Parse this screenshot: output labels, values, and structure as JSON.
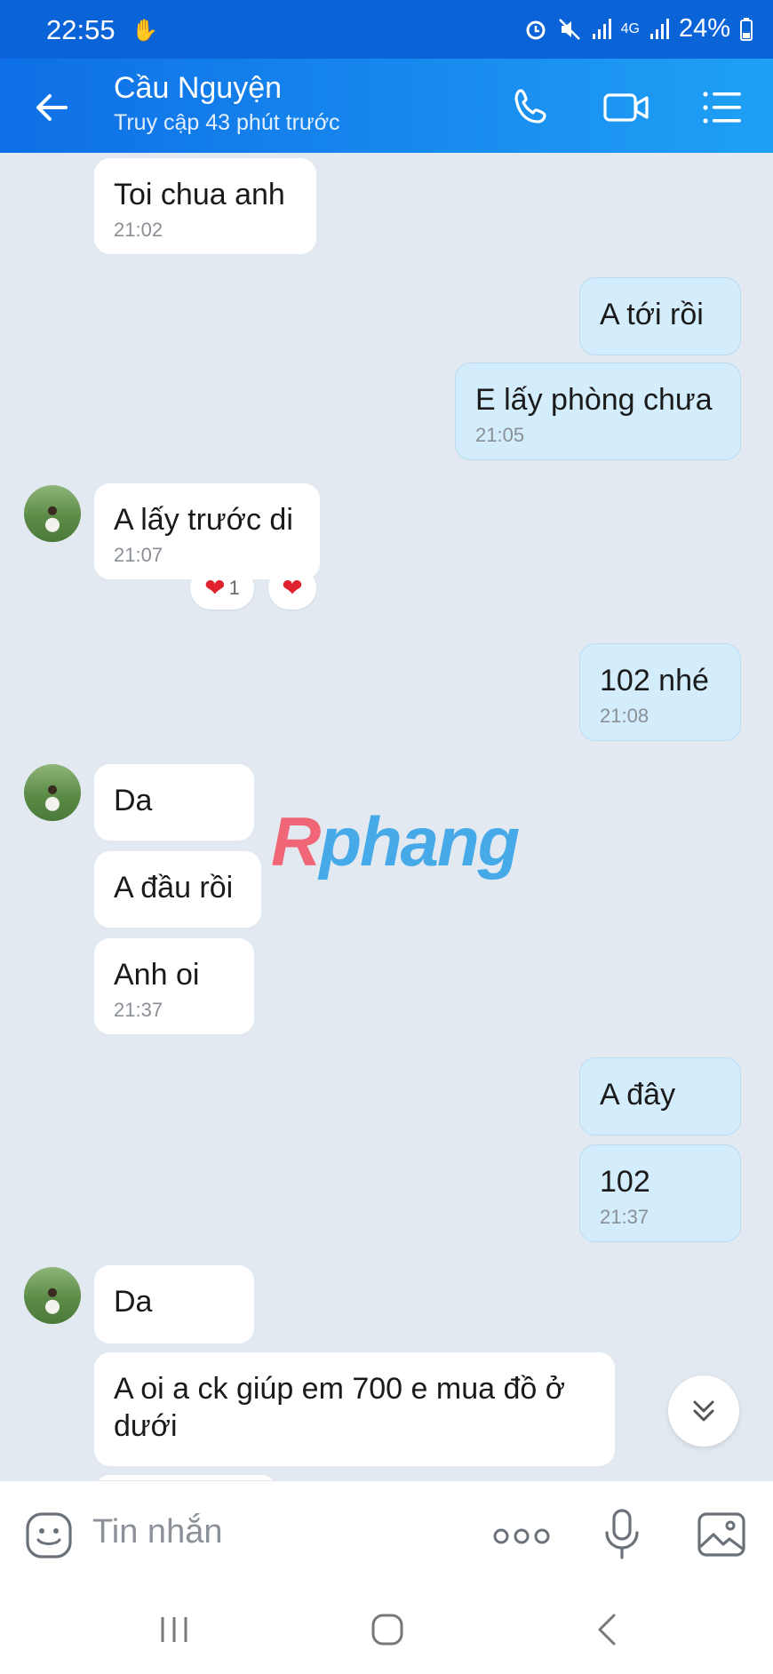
{
  "status_bar": {
    "time": "22:55",
    "battery": "24%",
    "network": "4G"
  },
  "header": {
    "contact_name": "Cầu Nguyện",
    "contact_status": "Truy cập 43 phút trước"
  },
  "messages": [
    {
      "side": "in",
      "text": "Toi chua anh",
      "time": "21:02"
    },
    {
      "side": "out",
      "text": "A tới rồi",
      "time": ""
    },
    {
      "side": "out",
      "text": "E lấy phòng chưa",
      "time": "21:05"
    },
    {
      "side": "in",
      "text": "A lấy trước di",
      "time": "21:07"
    },
    {
      "side": "out",
      "text": "102 nhé",
      "time": "21:08"
    },
    {
      "side": "in",
      "text": "Da",
      "time": ""
    },
    {
      "side": "in",
      "text": "A đầu rồi",
      "time": ""
    },
    {
      "side": "in",
      "text": "Anh oi",
      "time": "21:37"
    },
    {
      "side": "out",
      "text": "A đây",
      "time": ""
    },
    {
      "side": "out",
      "text": "102",
      "time": "21:37"
    },
    {
      "side": "in",
      "text": "Da",
      "time": ""
    },
    {
      "side": "in",
      "text": "A oi a ck giúp em 700 e mua đồ ở dưới",
      "time": ""
    }
  ],
  "reaction": {
    "count": "1"
  },
  "watermark": {
    "first": "R",
    "rest": "phang"
  },
  "input": {
    "placeholder": "Tin nhắn"
  },
  "colors": {
    "header_start": "#0e6fe6",
    "header_end": "#1fa0f5",
    "out_bubble": "#d4edfd",
    "chat_bg": "#e2e9f1",
    "heart": "#e0222f"
  }
}
